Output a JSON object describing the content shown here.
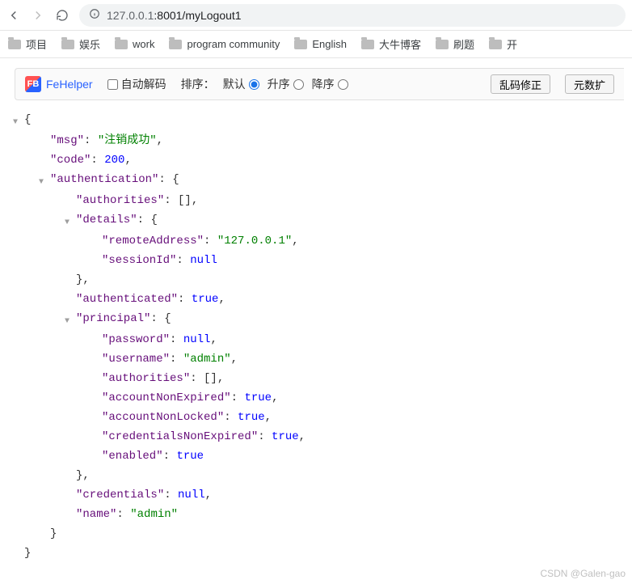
{
  "browser": {
    "url_prefix": "127.0.0.1",
    "url_rest": ":8001/myLogout1"
  },
  "bookmarks": [
    "项目",
    "娱乐",
    "work",
    "program community",
    "English",
    "大牛博客",
    "刷题",
    "开"
  ],
  "fehelper": {
    "name": "FeHelper",
    "auto_decode_label": "自动解码",
    "sort_label": "排序：",
    "opt_default": "默认",
    "opt_asc": "升序",
    "opt_desc": "降序",
    "btn_fix": "乱码修正",
    "btn_expand": "元数扩"
  },
  "json_rows": [
    {
      "depth": 0,
      "tri": true,
      "type": "open",
      "brace": "{"
    },
    {
      "depth": 1,
      "key": "msg",
      "type": "str",
      "val": "注销成功",
      "comma": true
    },
    {
      "depth": 1,
      "key": "code",
      "type": "num",
      "val": "200",
      "comma": true
    },
    {
      "depth": 1,
      "tri": true,
      "key": "authentication",
      "type": "open",
      "brace": "{"
    },
    {
      "depth": 2,
      "key": "authorities",
      "type": "arr",
      "val": "[]",
      "comma": true
    },
    {
      "depth": 2,
      "tri": true,
      "key": "details",
      "type": "open",
      "brace": "{"
    },
    {
      "depth": 3,
      "key": "remoteAddress",
      "type": "str",
      "val": "127.0.0.1",
      "comma": true
    },
    {
      "depth": 3,
      "key": "sessionId",
      "type": "null",
      "val": "null"
    },
    {
      "depth": 2,
      "type": "close",
      "brace": "}",
      "comma": true
    },
    {
      "depth": 2,
      "key": "authenticated",
      "type": "bool",
      "val": "true",
      "comma": true
    },
    {
      "depth": 2,
      "tri": true,
      "key": "principal",
      "type": "open",
      "brace": "{"
    },
    {
      "depth": 3,
      "key": "password",
      "type": "null",
      "val": "null",
      "comma": true
    },
    {
      "depth": 3,
      "key": "username",
      "type": "str",
      "val": "admin",
      "comma": true
    },
    {
      "depth": 3,
      "key": "authorities",
      "type": "arr",
      "val": "[]",
      "comma": true
    },
    {
      "depth": 3,
      "key": "accountNonExpired",
      "type": "bool",
      "val": "true",
      "comma": true
    },
    {
      "depth": 3,
      "key": "accountNonLocked",
      "type": "bool",
      "val": "true",
      "comma": true
    },
    {
      "depth": 3,
      "key": "credentialsNonExpired",
      "type": "bool",
      "val": "true",
      "comma": true
    },
    {
      "depth": 3,
      "key": "enabled",
      "type": "bool",
      "val": "true"
    },
    {
      "depth": 2,
      "type": "close",
      "brace": "}",
      "comma": true
    },
    {
      "depth": 2,
      "key": "credentials",
      "type": "null",
      "val": "null",
      "comma": true
    },
    {
      "depth": 2,
      "key": "name",
      "type": "str",
      "val": "admin"
    },
    {
      "depth": 1,
      "type": "close",
      "brace": "}"
    },
    {
      "depth": 0,
      "type": "close",
      "brace": "}"
    }
  ],
  "watermark": "CSDN @Galen-gao"
}
